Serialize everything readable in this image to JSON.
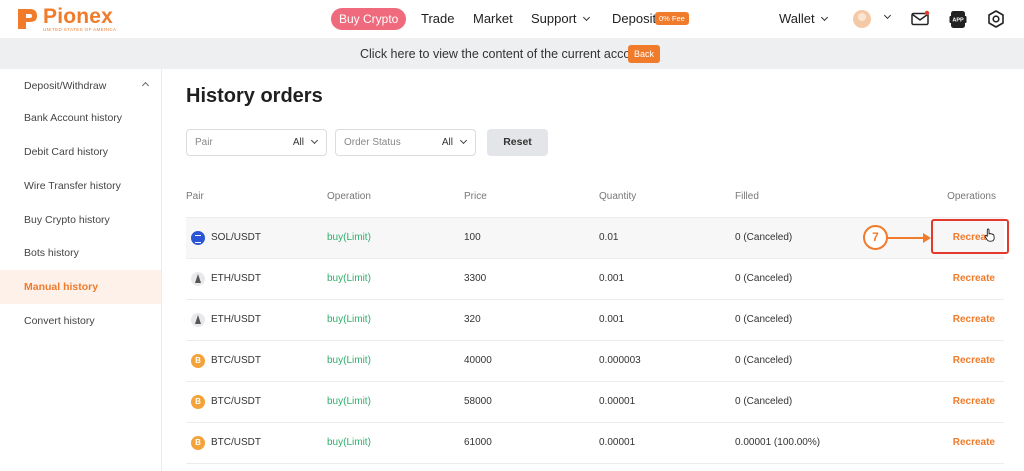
{
  "nav": {
    "logo_name": "Pionex",
    "logo_sub": "UNITED STATES OF AMERICA",
    "buy_crypto": "Buy Crypto",
    "trade": "Trade",
    "market": "Market",
    "support": "Support",
    "deposit": "Deposit",
    "deposit_badge": "0% Fee",
    "wallet": "Wallet",
    "accent_color": "#f07b2b"
  },
  "banner": {
    "text": "Click here to view the content of the current account",
    "back": "Back"
  },
  "sidebar": {
    "items": [
      {
        "label": "Deposit/Withdraw"
      },
      {
        "label": "Bank Account history"
      },
      {
        "label": "Debit Card history"
      },
      {
        "label": "Wire Transfer history"
      },
      {
        "label": "Buy Crypto history"
      },
      {
        "label": "Bots history"
      },
      {
        "label": "Manual history",
        "active": true
      },
      {
        "label": "Convert history"
      }
    ]
  },
  "main": {
    "title": "History orders",
    "filters": {
      "pair_placeholder": "Pair",
      "pair_value": "All",
      "status_placeholder": "Order Status",
      "status_value": "All",
      "reset": "Reset"
    },
    "columns": [
      "Pair",
      "Operation",
      "Price",
      "Quantity",
      "Filled",
      "Operations"
    ],
    "rows": [
      {
        "coin": "sol-icon",
        "pair": "SOL/USDT",
        "operation": "buy(Limit)",
        "price": "100",
        "quantity": "0.01",
        "filled": "0 (Canceled)",
        "action": "Recreate"
      },
      {
        "coin": "eth-icon",
        "pair": "ETH/USDT",
        "operation": "buy(Limit)",
        "price": "3300",
        "quantity": "0.001",
        "filled": "0 (Canceled)",
        "action": "Recreate"
      },
      {
        "coin": "eth-icon",
        "pair": "ETH/USDT",
        "operation": "buy(Limit)",
        "price": "320",
        "quantity": "0.001",
        "filled": "0 (Canceled)",
        "action": "Recreate"
      },
      {
        "coin": "btc-icon",
        "pair": "BTC/USDT",
        "operation": "buy(Limit)",
        "price": "40000",
        "quantity": "0.000003",
        "filled": "0 (Canceled)",
        "action": "Recreate"
      },
      {
        "coin": "btc-icon",
        "pair": "BTC/USDT",
        "operation": "buy(Limit)",
        "price": "58000",
        "quantity": "0.00001",
        "filled": "0 (Canceled)",
        "action": "Recreate"
      },
      {
        "coin": "btc-icon",
        "pair": "BTC/USDT",
        "operation": "buy(Limit)",
        "price": "61000",
        "quantity": "0.00001",
        "filled": "0.00001 (100.00%)",
        "action": "Recreate"
      }
    ]
  },
  "annotation": {
    "step": "7"
  }
}
